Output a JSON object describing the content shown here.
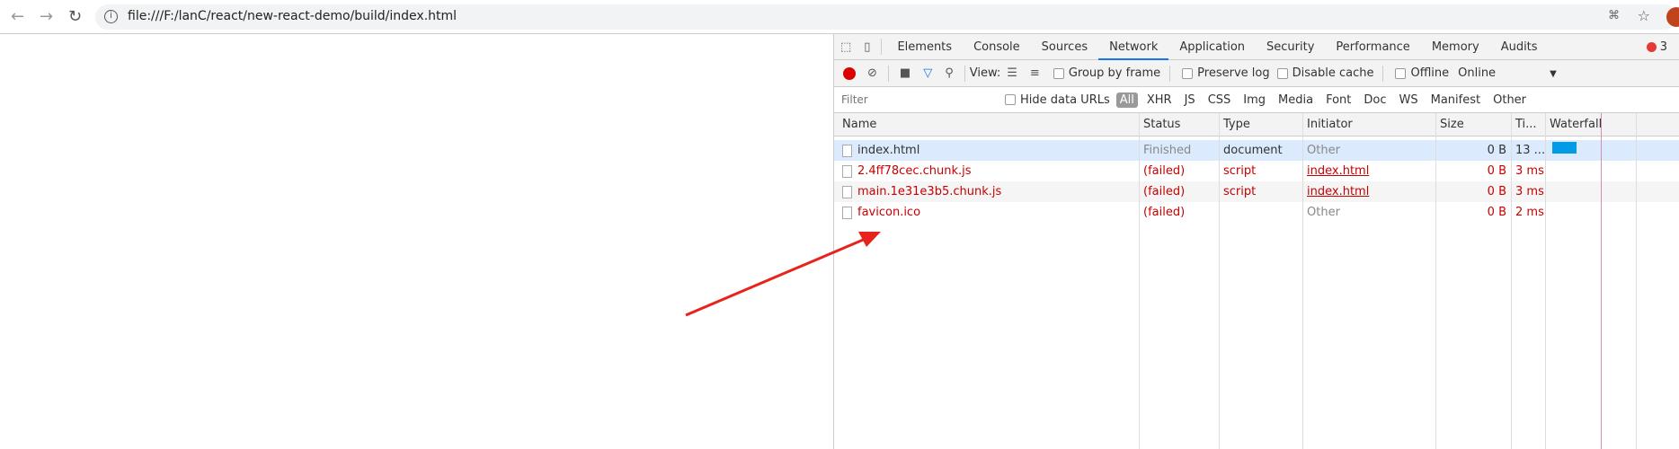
{
  "browser": {
    "url": "file:///F:/lanC/react/new-react-demo/build/index.html"
  },
  "devtools": {
    "tabs": [
      "Elements",
      "Console",
      "Sources",
      "Network",
      "Application",
      "Security",
      "Performance",
      "Memory",
      "Audits"
    ],
    "active_tab": "Network",
    "error_count": "3",
    "toolbar": {
      "view_label": "View:",
      "group_by_frame": "Group by frame",
      "preserve_log": "Preserve log",
      "disable_cache": "Disable cache",
      "offline": "Offline",
      "throttle": "Online"
    },
    "filter": {
      "placeholder": "Filter",
      "hide_data_urls": "Hide data URLs",
      "types": [
        "All",
        "XHR",
        "JS",
        "CSS",
        "Img",
        "Media",
        "Font",
        "Doc",
        "WS",
        "Manifest",
        "Other"
      ]
    },
    "columns": [
      "Name",
      "Status",
      "Type",
      "Initiator",
      "Size",
      "Ti...",
      "Waterfall"
    ],
    "rows": [
      {
        "name": "index.html",
        "status": "Finished",
        "type": "document",
        "initiator": "Other",
        "size": "0 B",
        "time": "13 ..."
      },
      {
        "name": "2.4ff78cec.chunk.js",
        "status": "(failed)",
        "type": "script",
        "initiator": "index.html",
        "size": "0 B",
        "time": "3 ms"
      },
      {
        "name": "main.1e31e3b5.chunk.js",
        "status": "(failed)",
        "type": "script",
        "initiator": "index.html",
        "size": "0 B",
        "time": "3 ms"
      },
      {
        "name": "favicon.ico",
        "status": "(failed)",
        "type": "",
        "initiator": "Other",
        "size": "0 B",
        "time": "2 ms"
      }
    ],
    "colors": {
      "failed": "#c80000",
      "selected_row": "#dbeafc",
      "waterfall_bar": "#039be5",
      "accent": "#1a73e8"
    }
  }
}
